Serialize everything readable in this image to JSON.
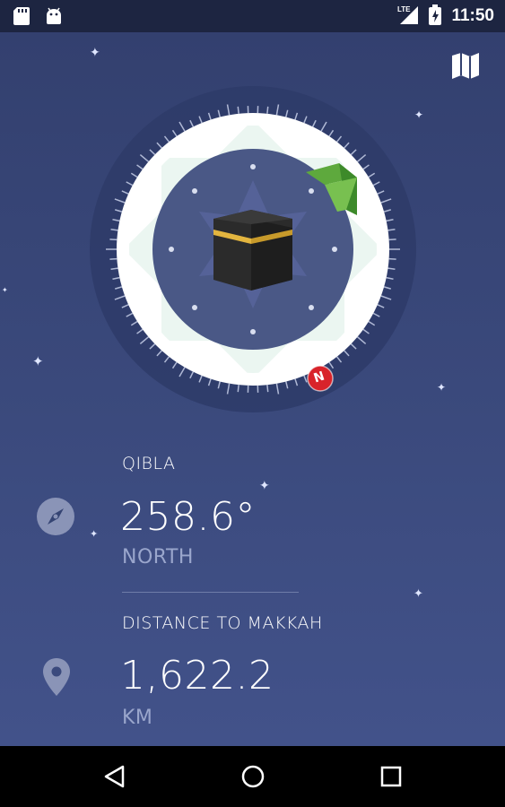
{
  "status_bar": {
    "time": "11:50",
    "network_label": "LTE",
    "icons": [
      "sd-card-icon",
      "android-icon",
      "lte-signal-icon",
      "battery-charging-icon"
    ]
  },
  "toolbar": {
    "map_icon": "map-icon"
  },
  "compass": {
    "center_image": "kaaba-icon",
    "north_marker_label": "N",
    "qibla_pointer": "qibla-pointer-icon"
  },
  "qibla": {
    "label": "QIBLA",
    "value": "258.6°",
    "direction": "NORTH",
    "icon": "compass-icon"
  },
  "distance": {
    "label": "DISTANCE TO MAKKAH",
    "value": "1,622.2",
    "unit": "KM",
    "icon": "location-pin-icon"
  },
  "nav_bar": {
    "icons": [
      "back-icon",
      "home-icon",
      "recents-icon"
    ]
  },
  "colors": {
    "background": "#3a497c",
    "status_bar": "#1d2541",
    "accent_green": "#6eab3a",
    "north_red": "#d8232a",
    "muted_text": "#9aa6cc"
  }
}
